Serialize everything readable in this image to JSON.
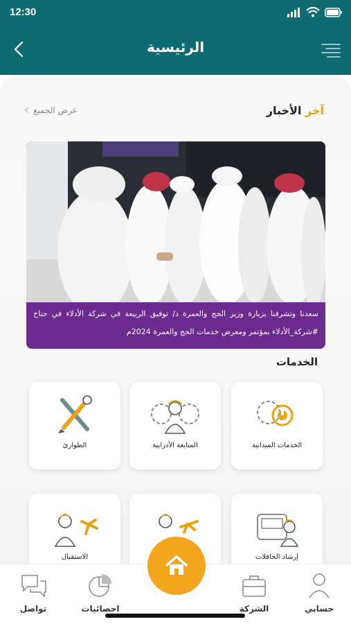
{
  "status": {
    "time": "12:30"
  },
  "header": {
    "title": "الرئيسية"
  },
  "news": {
    "title_accent": "آخر",
    "title_rest": "الأخبار",
    "view_all": "عرض الجميع",
    "caption": "سعدنا وتشرفنا بزيارة وزير الحج والعمرة د/ توفيق الربيعة في شركة الأدلاء في جناح #شركة_الأدلاء بمؤتمر ومعرض خدمات الحج والعمرة 2024م"
  },
  "services": {
    "title": "الخدمات",
    "items": [
      {
        "label": "الخدمات الميدانية",
        "icon": "field-services-icon"
      },
      {
        "label": "المتابعة الأدرابية",
        "icon": "admin-followup-icon"
      },
      {
        "label": "الطوارئ",
        "icon": "emergency-tools-icon"
      },
      {
        "label": "إرشاد الحافلات",
        "icon": "bus-guidance-icon"
      },
      {
        "label": "",
        "icon": "departure-icon"
      },
      {
        "label": "الاستقبال",
        "icon": "reception-icon"
      }
    ]
  },
  "tabs": {
    "account": "حسابي",
    "company": "الشركة",
    "stats": "احصائيات",
    "contact": "تواصل"
  },
  "colors": {
    "primary": "#0f6b72",
    "accent": "#e6a315",
    "news_band": "#6a2a8e",
    "fab": "#f3a51e"
  }
}
